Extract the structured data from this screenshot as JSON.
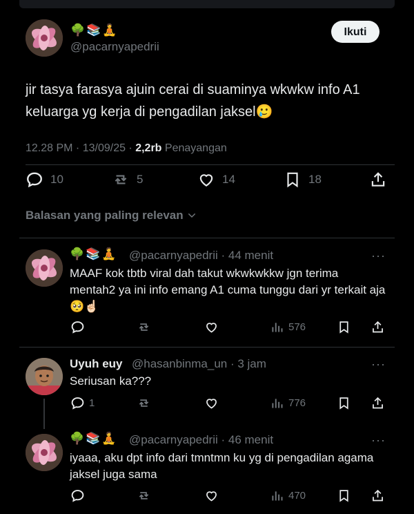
{
  "main_tweet": {
    "emojis": "🌳📚🧘",
    "handle": "@pacarnyapedrii",
    "follow_label": "Ikuti",
    "text": "jir tasya farasya ajuin cerai di suaminya wkwkw info A1 keluarga yg kerja di pengadilan jaksel🥲",
    "time": "12.28 PM · 13/09/25 · ",
    "views": "2,2rb",
    "views_label": " Penayangan",
    "replies": "10",
    "retweets": "5",
    "likes": "14",
    "bookmarks": "18"
  },
  "sort_label": "Balasan yang paling relevan",
  "replies": [
    {
      "emojis": "🌳📚🧘",
      "handle_time": "@pacarnyapedrii · 44 menit",
      "text": "MAAF kok tbtb viral dah takut wkwkwkkw jgn terima mentah2 ya ini info emang A1 cuma tunggu dari yr terkait aja🥺☝🏻",
      "reply_count": "",
      "views": "576"
    },
    {
      "name": "Uyuh euy",
      "handle_time": "@hasanbinma_un · 3 jam",
      "text": "Seriusan ka???",
      "reply_count": "1",
      "views": "776"
    },
    {
      "emojis": "🌳📚🧘",
      "handle_time": "@pacarnyapedrii · 46 menit",
      "text": "iyaaa, aku dpt info dari tmntmn ku yg di pengadilan agama jaksel juga sama",
      "reply_count": "",
      "views": "470"
    }
  ],
  "more_glyph": "···",
  "colors": {
    "background": "#000000",
    "text": "#e7e9ea",
    "muted": "#71767b",
    "divider": "#2f3336",
    "button_bg": "#eff3f4"
  }
}
